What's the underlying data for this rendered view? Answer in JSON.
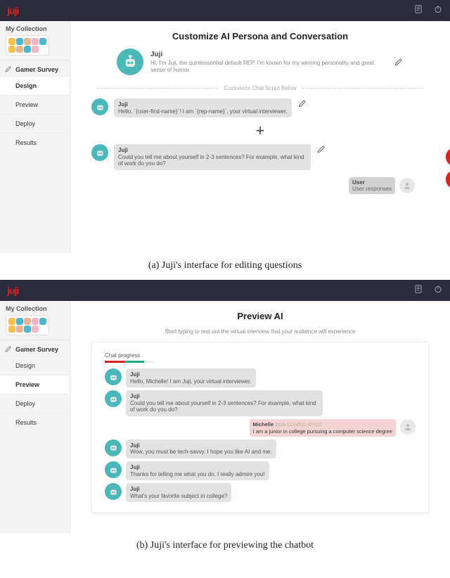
{
  "captions": {
    "a": "(a) Juji's interface for editing questions",
    "b": "(b) Juji's interface for previewing the chatbot"
  },
  "logo": "juji",
  "sidebar": {
    "collection_label": "My Collection",
    "edit_label": "Gamer Survey",
    "nav": [
      "Design",
      "Preview",
      "Deploy",
      "Results"
    ]
  },
  "edit_panel": {
    "title": "Customize AI Persona and Conversation",
    "persona_name": "Juji",
    "persona_desc": "Hi, I'm Juji, the quintessential default REP. I'm known for my winning personality and great sense of humor.",
    "separator": "Customize Chat Script Below",
    "msg1": {
      "name": "Juji",
      "text": "Hello, `{user-first-name}`! I am `{rep-name}`, your virtual interviewer."
    },
    "msg2": {
      "name": "Juji",
      "text": "Could you tell me about yourself in 2-3 sentences? For example, what kind of work do you do?"
    },
    "user_label": "User",
    "user_text": "User responses"
  },
  "preview_panel": {
    "title": "Preview AI",
    "subtitle": "Start typing to test out the virtual interview that your audience will experience",
    "progress_label": "Chat progress",
    "msgs": [
      {
        "name": "Juji",
        "text": "Hello, Michelle! I am Juji, your virtual interviewer."
      },
      {
        "name": "Juji",
        "text": "Could you tell me about yourself in 2-3 sentences? For example, what kind of work do you do?"
      }
    ],
    "user_msg": {
      "name": "Michelle",
      "meta": "2018-12-04T21:42:02Z",
      "text": "I am a junior in college pursuing a computer science degree"
    },
    "replies": [
      {
        "name": "Juji",
        "text": "Wow, you must be tech-savvy. I hope you like AI and me."
      },
      {
        "name": "Juji",
        "text": "Thanks for telling me what you do. I really admire you!"
      },
      {
        "name": "Juji",
        "text": "What's your favorite subject in college?"
      }
    ]
  }
}
